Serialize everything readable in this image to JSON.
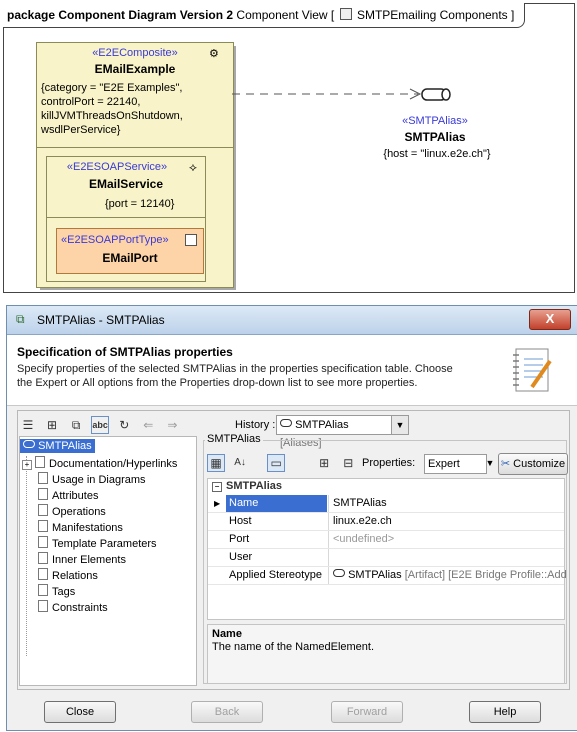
{
  "diagram": {
    "package_kind": "package",
    "package_name": "Component Diagram Version 2",
    "view_name": "Component View [",
    "view_target": "SMTPEmailing Components ]",
    "example": {
      "stereotype": "«E2EComposite»",
      "name": "EMailExample",
      "tags": [
        "{category = \"E2E Examples\",",
        "controlPort = 22140,",
        "killJVMThreadsOnShutdown,",
        "wsdlPerService}"
      ]
    },
    "service": {
      "stereotype": "«E2ESOAPService»",
      "name": "EMailService",
      "tags": "{port = 12140}"
    },
    "port": {
      "stereotype": "«E2ESOAPPortType»",
      "name": "EMailPort"
    },
    "alias": {
      "stereotype": "«SMTPAlias»",
      "name": "SMTPAlias",
      "tags": "{host = \"linux.e2e.ch\"}"
    }
  },
  "dialog": {
    "title": "SMTPAlias - SMTPAlias",
    "close_glyph": "X",
    "header_title": "Specification of SMTPAlias properties",
    "header_desc": "Specify properties of the selected SMTPAlias in the properties specification table. Choose the Expert or All options from the Properties drop-down list to see more properties.",
    "history_label": "History :",
    "history_value": "SMTPAlias",
    "history_suffix": "[Aliases]",
    "tree_root": "SMTPAlias",
    "tree_items": [
      "Documentation/Hyperlinks",
      "Usage in Diagrams",
      "Attributes",
      "Operations",
      "Manifestations",
      "Template Parameters",
      "Inner Elements",
      "Relations",
      "Tags",
      "Constraints"
    ],
    "group_legend": "SMTPAlias",
    "properties_label": "Properties:",
    "properties_value": "Expert",
    "customize_label": "Customize",
    "grid_group": "SMTPAlias",
    "rows": [
      {
        "key": "Name",
        "value": "SMTPAlias"
      },
      {
        "key": "Host",
        "value": "linux.e2e.ch"
      },
      {
        "key": "Port",
        "value": "<undefined>"
      },
      {
        "key": "User",
        "value": ""
      },
      {
        "key": "Applied Stereotype",
        "value": "SMTPAlias",
        "suffix": "[Artifact] [E2E Bridge Profile::Add"
      }
    ],
    "desc_title": "Name",
    "desc_text": "The name of the NamedElement.",
    "buttons": {
      "close": "Close",
      "back": "Back",
      "forward": "Forward",
      "help": "Help"
    }
  }
}
